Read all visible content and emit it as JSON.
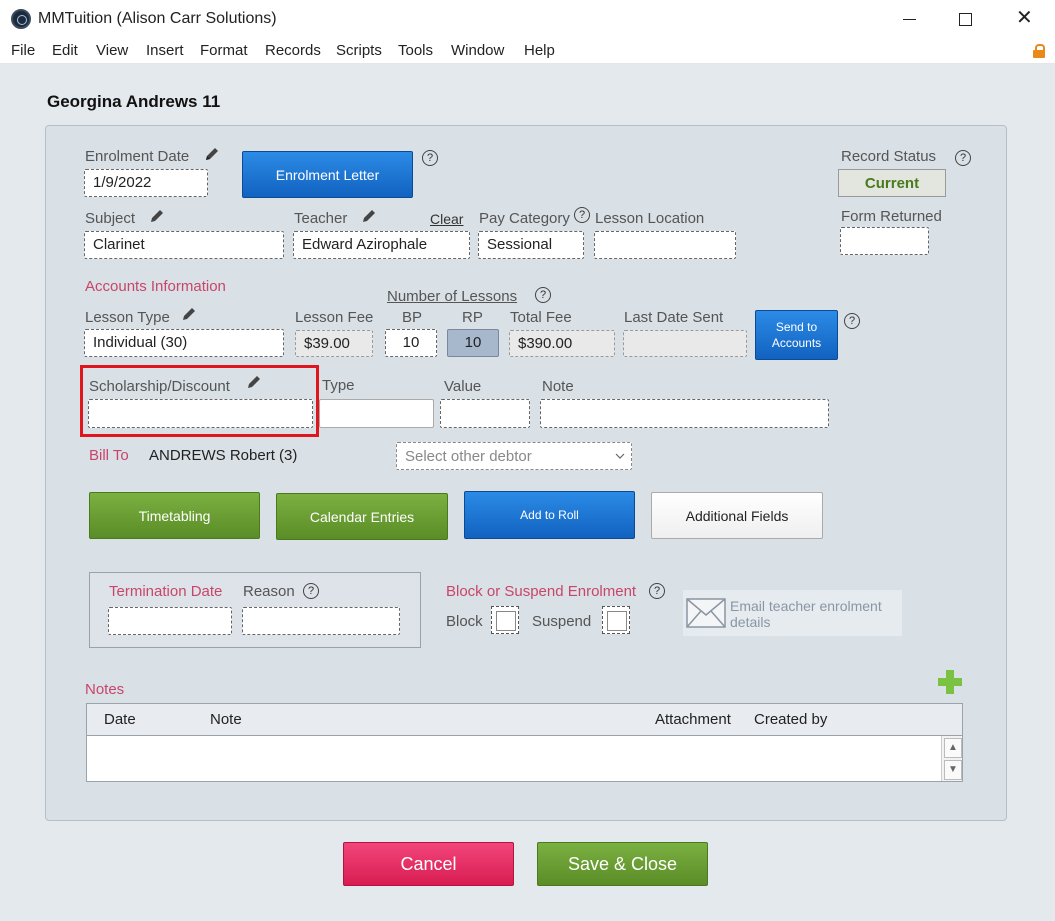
{
  "window": {
    "title": "MMTuition (Alison Carr Solutions)",
    "menu": [
      "File",
      "Edit",
      "View",
      "Insert",
      "Format",
      "Records",
      "Scripts",
      "Tools",
      "Window",
      "Help"
    ]
  },
  "record": {
    "heading": "Georgina Andrews 11"
  },
  "enrolment": {
    "date_label": "Enrolment Date",
    "date_value": "1/9/2022",
    "letter_button": "Enrolment Letter",
    "status_label": "Record Status",
    "status_value": "Current",
    "form_returned_label": "Form Returned",
    "form_returned_value": "",
    "subject_label": "Subject",
    "subject_value": "Clarinet",
    "teacher_label": "Teacher",
    "teacher_value": "Edward Azirophale",
    "clear_link": "Clear",
    "pay_category_label": "Pay Category",
    "pay_category_value": "Sessional",
    "lesson_location_label": "Lesson Location",
    "lesson_location_value": ""
  },
  "accounts": {
    "section_label": "Accounts Information",
    "lesson_type_label": "Lesson Type",
    "lesson_type_value": "Individual (30)",
    "lesson_fee_label": "Lesson Fee",
    "lesson_fee_value": "$39.00",
    "number_of_lessons_label": "Number of Lessons",
    "bp_label": "BP",
    "bp_value": "10",
    "rp_label": "RP",
    "rp_value": "10",
    "total_fee_label": "Total Fee",
    "total_fee_value": "$390.00",
    "last_date_sent_label": "Last Date Sent",
    "last_date_sent_value": "",
    "send_button": "Send to Accounts"
  },
  "scholarship": {
    "label": "Scholarship/Discount",
    "value": "",
    "type_label": "Type",
    "type_value": "",
    "value_label": "Value",
    "value_value": "",
    "note_label": "Note",
    "note_value": ""
  },
  "billing": {
    "bill_to_label": "Bill To",
    "bill_to_value": "ANDREWS Robert (3)",
    "debtor_placeholder": "Select other debtor"
  },
  "actions": {
    "timetabling": "Timetabling",
    "calendar_entries": "Calendar Entries",
    "add_to_roll": "Add to Roll",
    "additional_fields": "Additional Fields"
  },
  "termination": {
    "date_label": "Termination Date",
    "reason_label": "Reason",
    "block_suspend_label": "Block or Suspend Enrolment",
    "block_label": "Block",
    "suspend_label": "Suspend",
    "email_label": "Email teacher enrolment details"
  },
  "notes": {
    "label": "Notes",
    "columns": [
      "Date",
      "Note",
      "Attachment",
      "Created by"
    ]
  },
  "footer": {
    "cancel": "Cancel",
    "save_close": "Save & Close"
  },
  "colors": {
    "blue_button": "#1a72d4",
    "green_button": "#6a9e32",
    "cancel_button": "#e82c5e",
    "status_text": "#4a7a1c",
    "section_label": "#c8466a",
    "highlight_box": "#e0161e"
  }
}
